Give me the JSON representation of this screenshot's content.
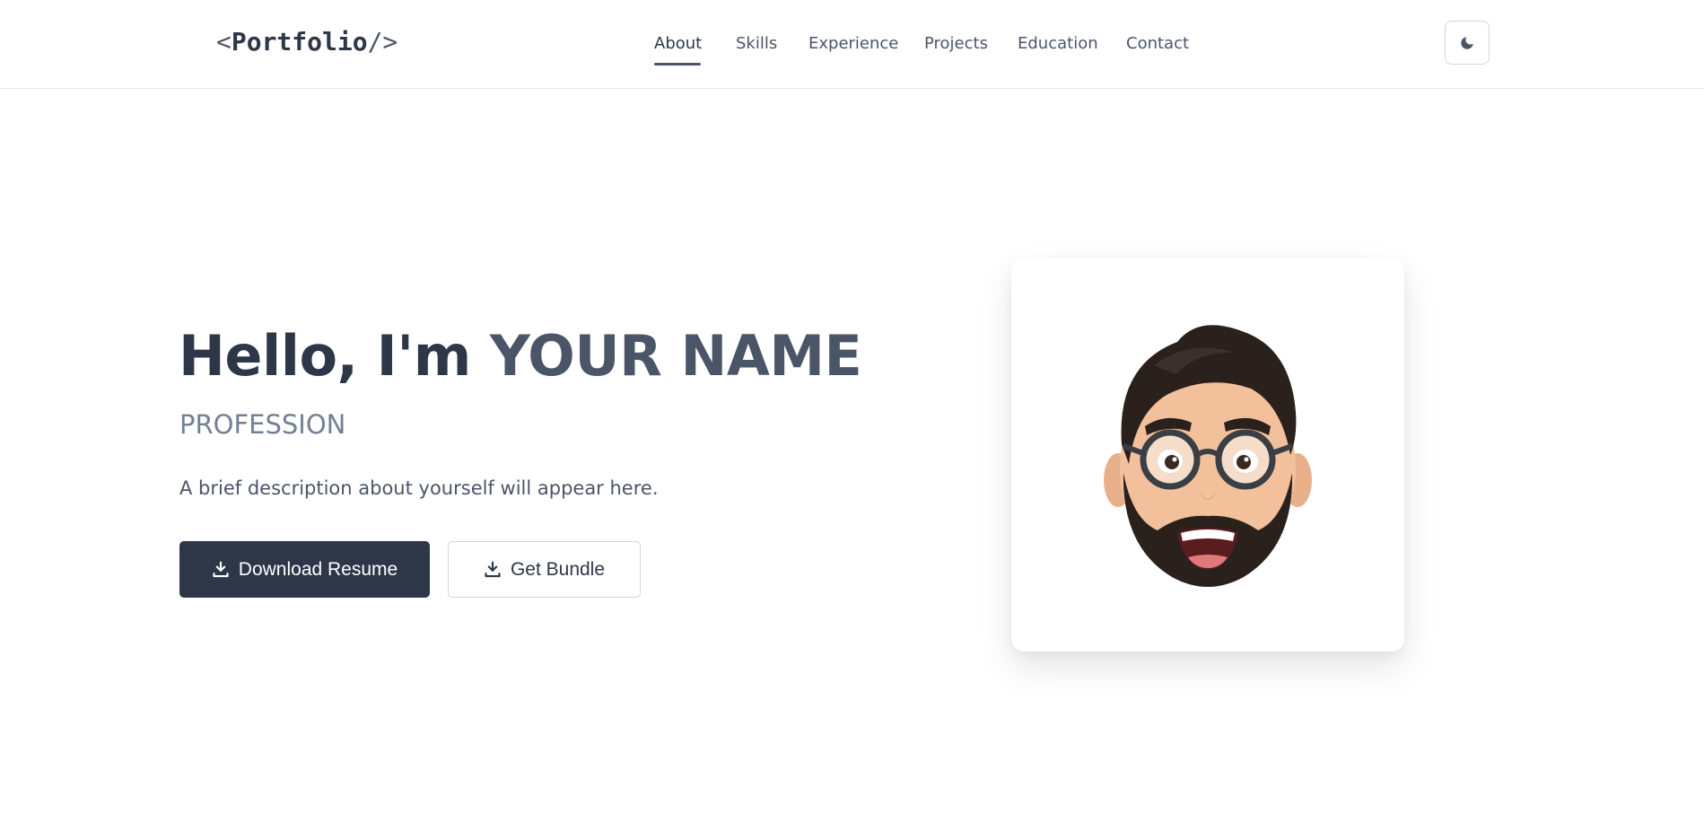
{
  "logo": {
    "open": "<",
    "name": "Portfolio",
    "close": "/>"
  },
  "nav": {
    "items": [
      {
        "label": "About",
        "active": true
      },
      {
        "label": "Skills"
      },
      {
        "label": "Experience"
      },
      {
        "label": "Projects"
      },
      {
        "label": "Education"
      },
      {
        "label": "Contact"
      }
    ],
    "theme_toggle_icon": "moon-icon"
  },
  "hero": {
    "greeting": "Hello, I'm ",
    "name": "YOUR NAME",
    "profession": "PROFESSION",
    "description": "A brief description about yourself will appear here.",
    "primary_button": {
      "label": "Download Resume",
      "icon": "download-icon"
    },
    "secondary_button": {
      "label": "Get Bundle",
      "icon": "download-icon"
    }
  },
  "avatar": {
    "icon": "memoji-avatar"
  },
  "colors": {
    "primary": "#2d3748",
    "muted": "#718096",
    "border": "#e5e7eb"
  }
}
